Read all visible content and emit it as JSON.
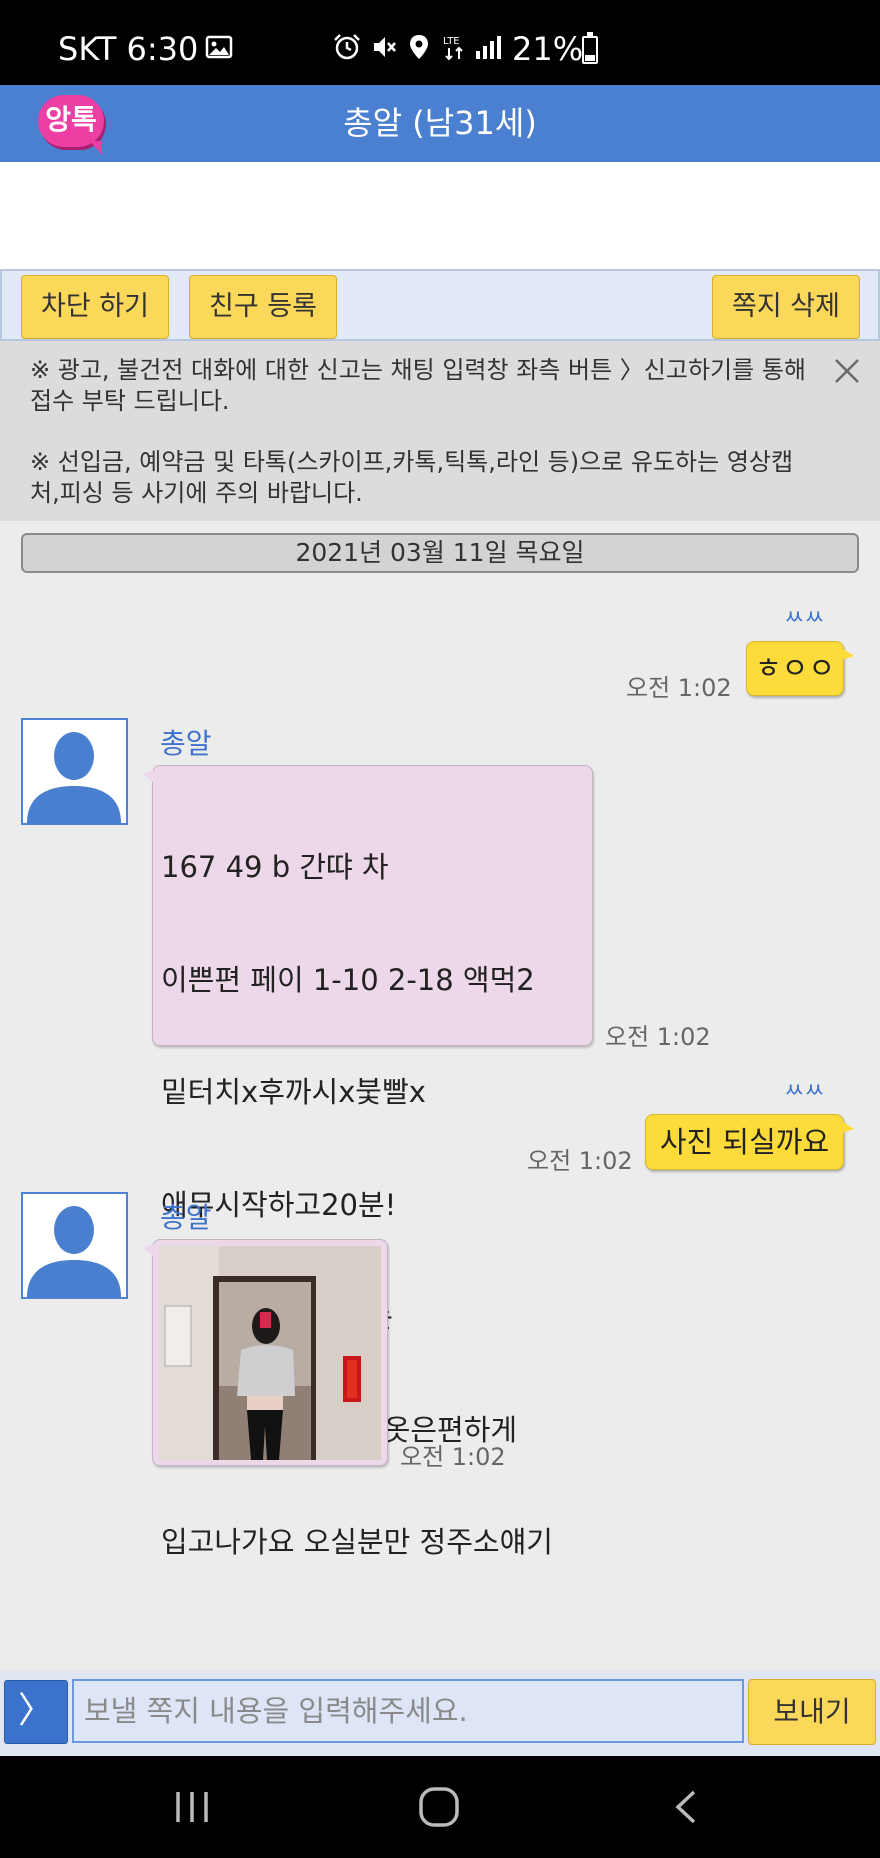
{
  "status_bar": {
    "carrier": "SKT",
    "time": "6:30",
    "battery": "21%",
    "network": "LTE"
  },
  "header": {
    "logo_text": "앙톡",
    "title": "총알 (남31세)"
  },
  "actions": {
    "block_label": "차단 하기",
    "add_friend_label": "친구 등록",
    "delete_label": "쪽지 삭제"
  },
  "notice": {
    "line1": "※ 광고, 불건전 대화에 대한 신고는 채팅 입력창 좌측 버튼 〉신고하기를 통해 접수 부탁 드립니다.",
    "line2": "※ 선입금, 예약금 및 타톡(스카이프,카톡,틱톡,라인 등)으로 유도하는 영상캡처,피싱 등 사기에 주의 바랍니다."
  },
  "date_separator": "2021년 03월 11일 목요일",
  "messages": [
    {
      "from": "me",
      "text": "ㅎㅇㅇ",
      "time": "오전 1:02",
      "status": "ㅆㅆ"
    },
    {
      "from": "other",
      "sender": "총알",
      "time": "오전 1:02",
      "lines": [
        "167 49 b 간땨 차",
        "이쁜편 페이 1-10 2-18 액먹2",
        "밑터치x후까시x붗빨x",
        "애무시작하고20분!",
        "사진은 친등 위치는",
        "반월당네거리근처 옷은편하게",
        "입고나가요 오실분만 정주소얘기"
      ]
    },
    {
      "from": "me",
      "text": "사진 되실까요",
      "time": "오전 1:02",
      "status": "ㅆㅆ"
    },
    {
      "from": "other",
      "sender": "총알",
      "time": "오전 1:02",
      "type": "photo"
    }
  ],
  "input": {
    "toggle_label": "〉",
    "placeholder": "보낼 쪽지 내용을 입력해주세요.",
    "send_label": "보내기"
  },
  "colors": {
    "header": "#4b7fcf",
    "accent_blue": "#3d73cc",
    "button_yellow": "#fbd85a",
    "my_bubble": "#fddb3a",
    "other_bubble": "#ecd8e8"
  }
}
